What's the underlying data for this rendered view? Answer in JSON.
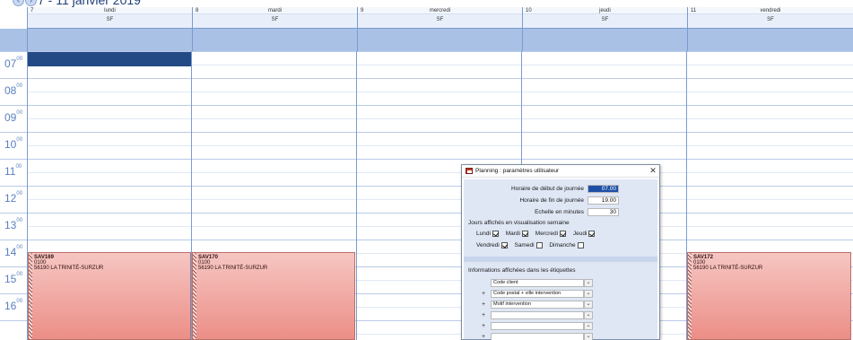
{
  "header": {
    "prev_icon": "chevron-left-icon",
    "next_icon": "chevron-right-icon",
    "week_title": "7 - 11 janvier 2019"
  },
  "days": [
    {
      "num": "7",
      "name": "lundi",
      "resource": "SF"
    },
    {
      "num": "8",
      "name": "mardi",
      "resource": "SF"
    },
    {
      "num": "9",
      "name": "mercredi",
      "resource": "SF"
    },
    {
      "num": "10",
      "name": "jeudi",
      "resource": "SF"
    },
    {
      "num": "11",
      "name": "vendredi",
      "resource": "SF"
    }
  ],
  "hours": [
    {
      "h": "07",
      "m": "00"
    },
    {
      "h": "08",
      "m": "00"
    },
    {
      "h": "09",
      "m": "00"
    },
    {
      "h": "10",
      "m": "00"
    },
    {
      "h": "11",
      "m": "00"
    },
    {
      "h": "12",
      "m": "00"
    },
    {
      "h": "13",
      "m": "00"
    },
    {
      "h": "14",
      "m": "00"
    },
    {
      "h": "15",
      "m": "00"
    },
    {
      "h": "16",
      "m": "00"
    }
  ],
  "appointments": [
    {
      "code": "SAV169",
      "line2": "0100",
      "line3": "56190 LA TRINITÉ-SURZUR"
    },
    {
      "code": "SAV170",
      "line2": "0100",
      "line3": "56190 LA TRINITÉ-SURZUR"
    },
    {
      "code": "SAV172",
      "line2": "0100",
      "line3": "56190 LA TRINITÉ-SURZUR"
    }
  ],
  "colors": {
    "accent": "#7a9bd1",
    "blocked_slot": "#244a86",
    "appointment": "#ec8e87",
    "dialog_bg": "#dfe7f5"
  },
  "dialog": {
    "title": "Planning : paramètres utilisateur",
    "close": "✕",
    "start_label": "Horaire de début de journée",
    "start_value": "07.00",
    "end_label": "Horaire de fin de journée",
    "end_value": "19.00",
    "scale_label": "Echelle en minutes",
    "scale_value": "30",
    "days_section": "Jours affichés en visualisation semaine",
    "day_checks": [
      {
        "label": "Lundi",
        "checked": true
      },
      {
        "label": "Mardi",
        "checked": true
      },
      {
        "label": "Mercredi",
        "checked": true
      },
      {
        "label": "Jeudi",
        "checked": true
      },
      {
        "label": "Vendredi",
        "checked": true
      },
      {
        "label": "Samedi",
        "checked": false
      },
      {
        "label": "Dimanche",
        "checked": false
      }
    ],
    "labels_section": "Informations affichées dans les étiquettes",
    "label_fields": [
      {
        "plus": "",
        "value": "Code client"
      },
      {
        "plus": "+",
        "value": "Code postal + ville intervention"
      },
      {
        "plus": "+",
        "value": "Motif intervention"
      },
      {
        "plus": "+",
        "value": ""
      },
      {
        "plus": "+",
        "value": ""
      },
      {
        "plus": "+",
        "value": ""
      }
    ]
  }
}
